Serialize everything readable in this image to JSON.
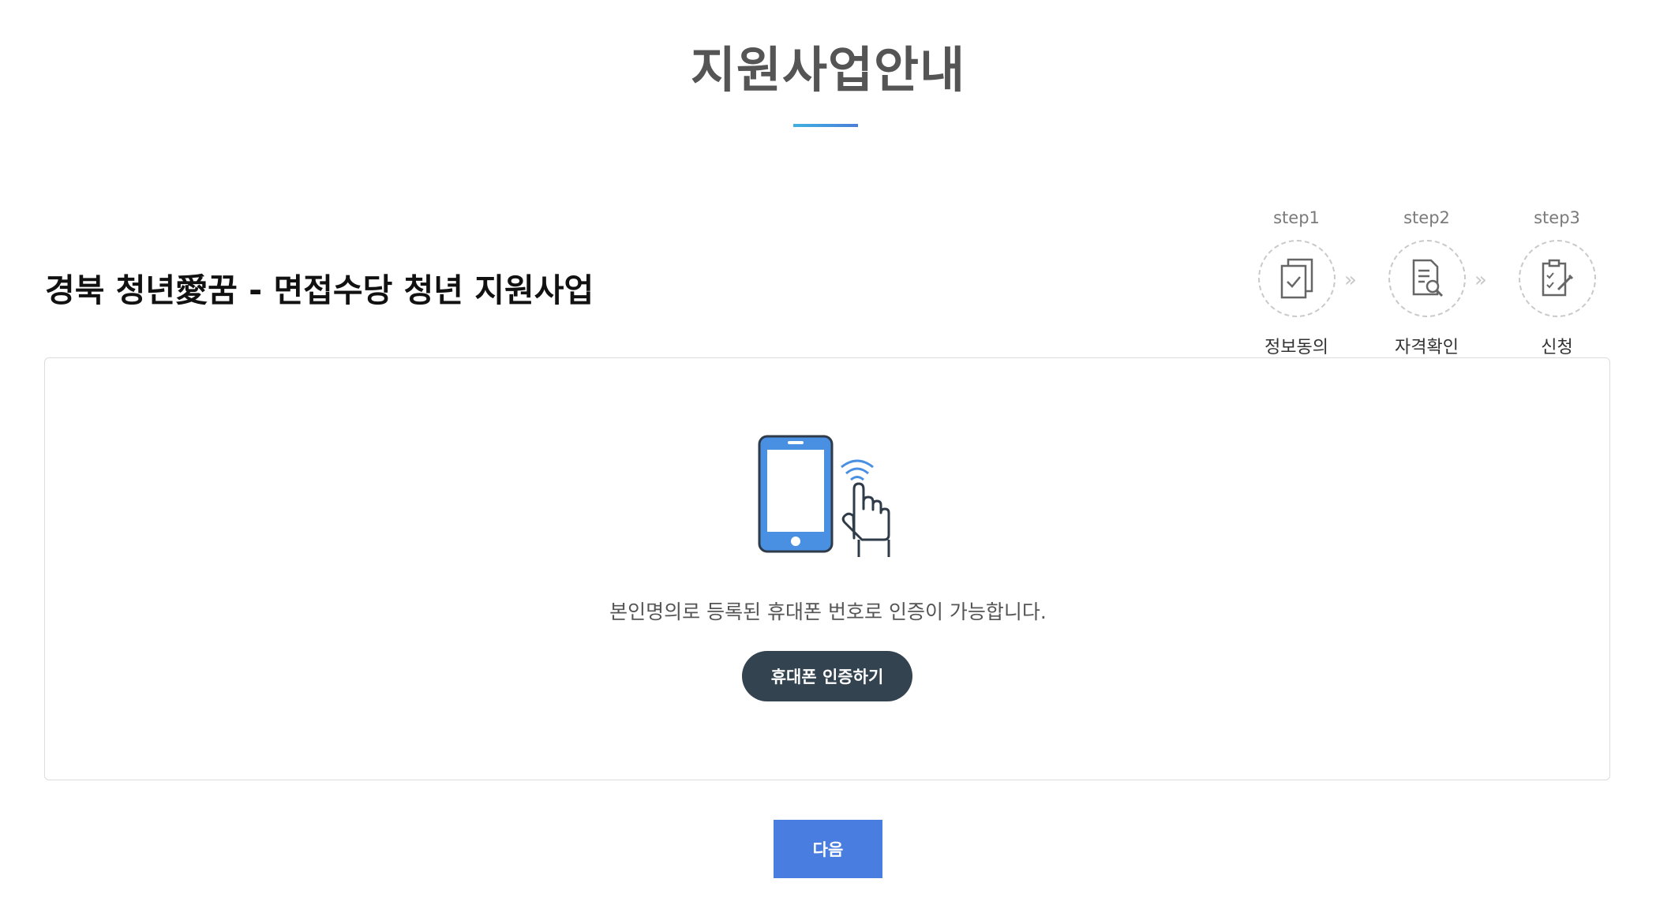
{
  "page": {
    "title": "지원사업안내"
  },
  "program": {
    "title": "경북 청년愛꿈 - 면접수당 청년 지원사업"
  },
  "steps": [
    {
      "num": "step1",
      "label": "정보동의",
      "icon": "document-check-icon"
    },
    {
      "num": "step2",
      "label": "자격확인",
      "icon": "document-search-icon"
    },
    {
      "num": "step3",
      "label": "신청",
      "icon": "application-edit-icon"
    }
  ],
  "step_arrow": "»",
  "auth": {
    "message": "본인명의로 등록된 휴대폰 번호로 인증이 가능합니다.",
    "button_label": "휴대폰 인증하기",
    "illustration": "phone-touch-icon"
  },
  "footer": {
    "next_label": "다음"
  },
  "colors": {
    "accent_blue": "#4a7de0",
    "dark_button": "#344350",
    "underline_start": "#3fb0e0",
    "underline_end": "#4a7fd9",
    "phone_blue": "#4a90e2"
  }
}
